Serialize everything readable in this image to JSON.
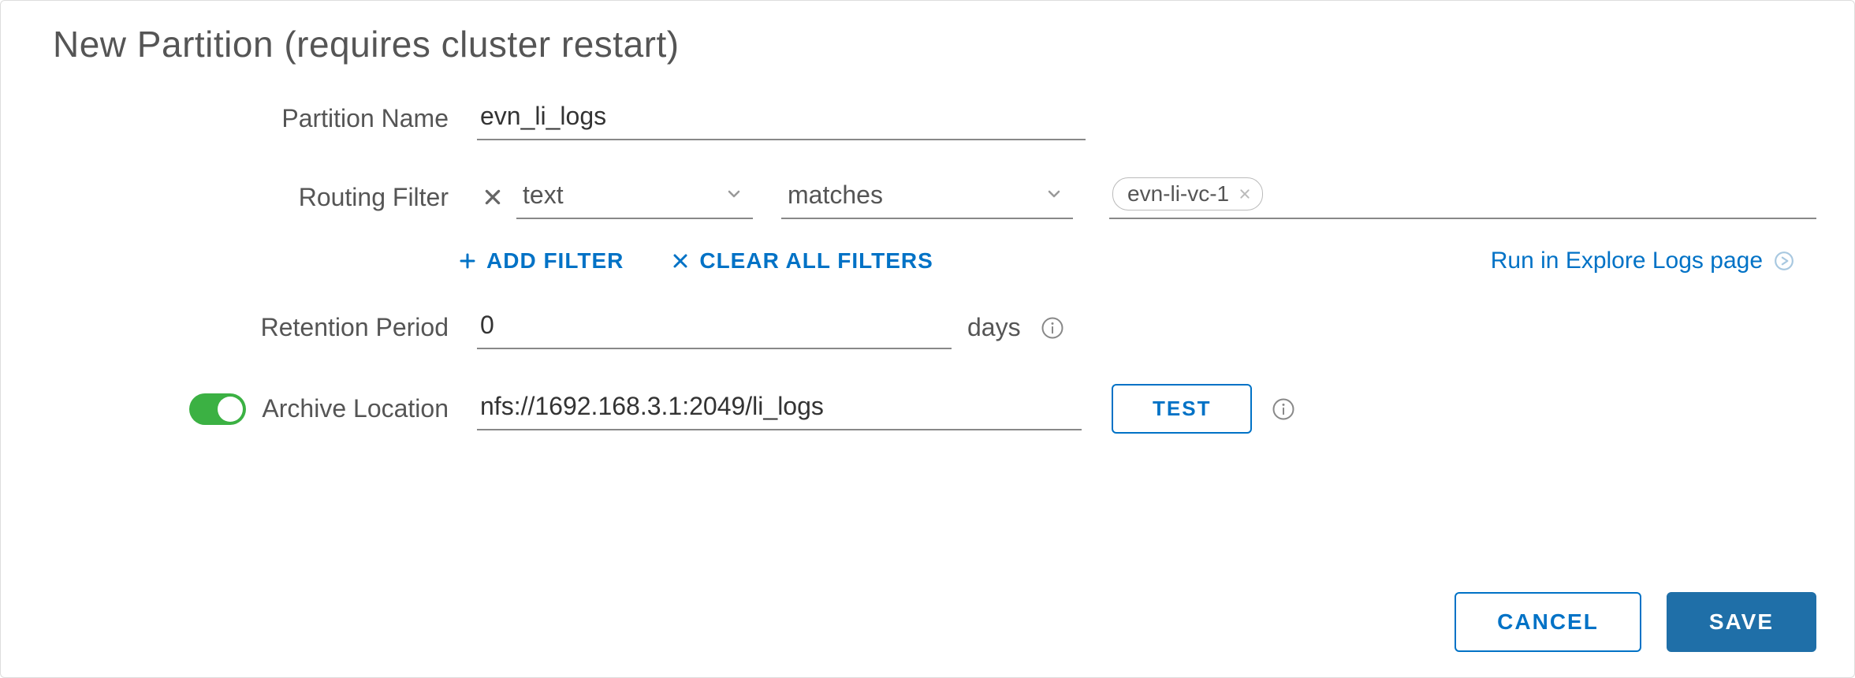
{
  "title": "New Partition (requires cluster restart)",
  "labels": {
    "partition_name": "Partition Name",
    "routing_filter": "Routing Filter",
    "retention_period": "Retention Period",
    "archive_location": "Archive Location"
  },
  "partition_name": {
    "value": "evn_li_logs"
  },
  "routing_filter": {
    "field_selected": "text",
    "operator_selected": "matches",
    "tags": [
      "evn-li-vc-1"
    ]
  },
  "filter_actions": {
    "add_filter": "ADD FILTER",
    "clear_all": "CLEAR ALL FILTERS",
    "run_link": "Run in Explore Logs page"
  },
  "retention": {
    "value": "0",
    "units": "days"
  },
  "archive": {
    "enabled": true,
    "value": "nfs://1692.168.3.1:2049/li_logs",
    "test_label": "TEST"
  },
  "buttons": {
    "cancel": "CANCEL",
    "save": "SAVE"
  }
}
